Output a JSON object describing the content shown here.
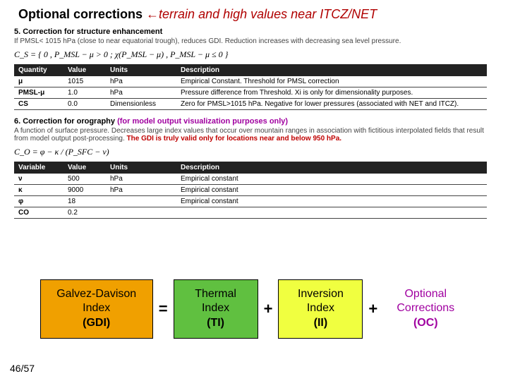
{
  "title": {
    "main": "Optional corrections",
    "arrow": "←",
    "sub": "terrain and high values near ITCZ/NET"
  },
  "sec5": {
    "heading": "5. Correction for structure enhancement",
    "desc": "If PMSL< 1015 hPa (close to near equatorial trough), reduces GDI. Reduction increases with decreasing sea level pressure.",
    "formula": "C_S = { 0 , P_MSL − μ > 0 ;  χ(P_MSL − μ) , P_MSL − μ ≤ 0 }",
    "hdr": {
      "q": "Quantity",
      "v": "Value",
      "u": "Units",
      "d": "Description"
    },
    "rows": [
      {
        "q": "μ",
        "v": "1015",
        "u": "hPa",
        "d": "Empirical Constant. Threshold for PMSL correction"
      },
      {
        "q": "PMSL-μ",
        "v": "1.0",
        "u": "hPa",
        "d": "Pressure difference from Threshold. Xi is only for dimensionality purposes."
      },
      {
        "q": "CS",
        "v": "0.0",
        "u": "Dimensionless",
        "d": "Zero for PMSL>1015 hPa. Negative for lower pressures (associated with NET and ITCZ)."
      }
    ]
  },
  "sec6": {
    "heading": "6. Correction for orography",
    "purple": " (for model output visualization purposes only)",
    "desc1": "A function of surface pressure. Decreases large index values that occur over mountain ranges in association with fictitious interpolated fields that result from model output post-processing. ",
    "desc2": "The GDI is truly valid only for locations near and below 950 hPa.",
    "formula": "C_O = φ − κ / (P_SFC − ν)",
    "hdr": {
      "q": "Variable",
      "v": "Value",
      "u": "Units",
      "d": "Description"
    },
    "rows": [
      {
        "q": "ν",
        "v": "500",
        "u": "hPa",
        "d": "Empirical constant"
      },
      {
        "q": "κ",
        "v": "9000",
        "u": "hPa",
        "d": "Empirical constant"
      },
      {
        "q": "φ",
        "v": "18",
        "u": "",
        "d": "Empirical constant"
      },
      {
        "q": "CO",
        "v": "0.2",
        "u": "",
        "d": ""
      }
    ]
  },
  "eq": {
    "gdi": {
      "l1": "Galvez-Davison",
      "l2": "Index",
      "l3": "(GDI)"
    },
    "eq": "=",
    "ti": {
      "l1": "Thermal",
      "l2": "Index",
      "l3": "(TI)"
    },
    "plus1": "+",
    "ii": {
      "l1": "Inversion",
      "l2": "Index",
      "l3": "(II)"
    },
    "plus2": "+",
    "oc": {
      "l1": "Optional",
      "l2": "Corrections",
      "l3": "(OC)"
    }
  },
  "footer": "46/57"
}
